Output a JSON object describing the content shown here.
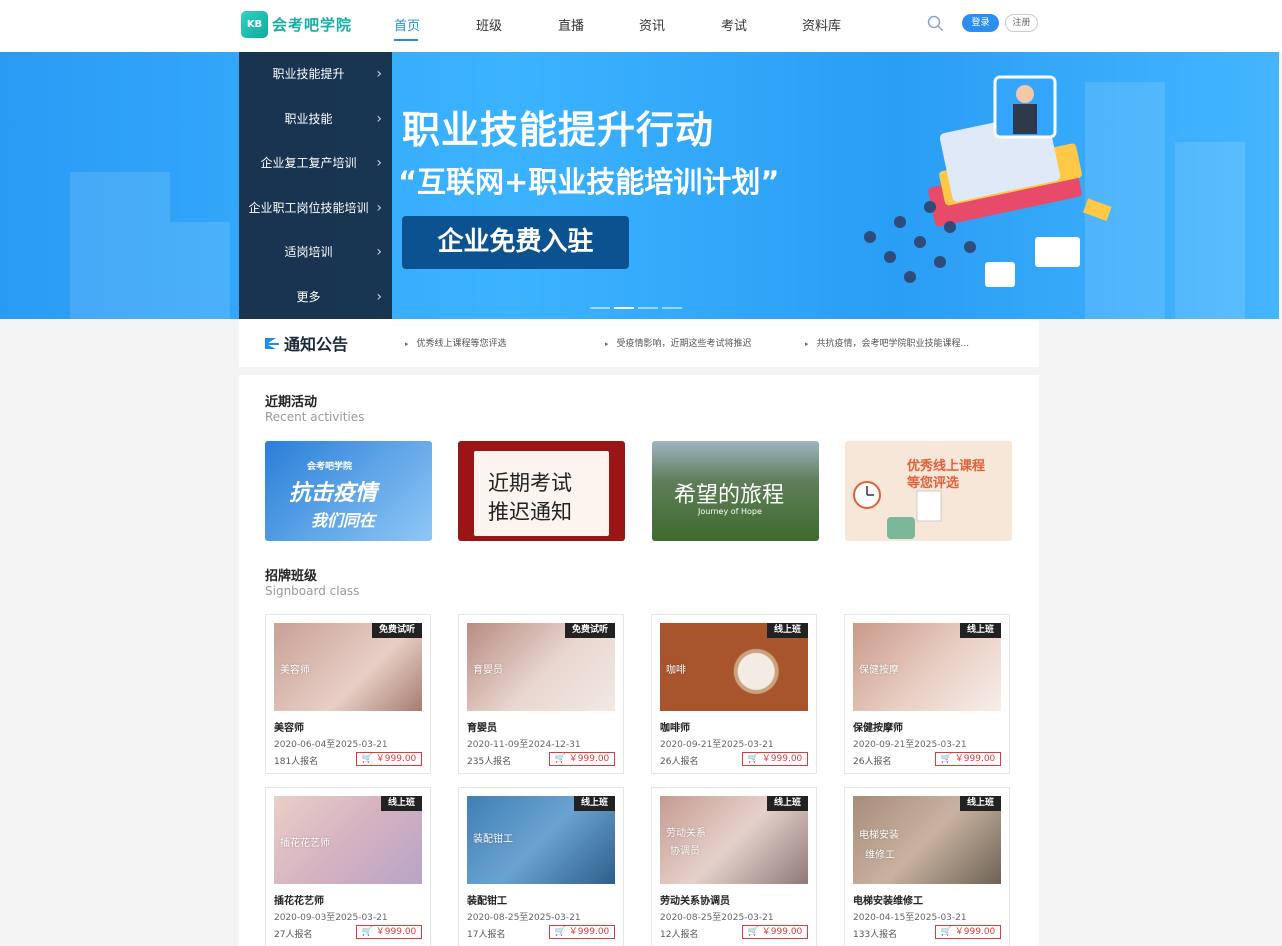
{
  "header": {
    "logo_text": "会考吧学院",
    "logo_mark": "KB",
    "nav": [
      "首页",
      "班级",
      "直播",
      "资讯",
      "考试",
      "资料库"
    ],
    "active_nav": "首页",
    "login_label": "登录",
    "register_label": "注册"
  },
  "banner": {
    "categories": [
      "职业技能提升",
      "职业技能",
      "企业复工复产培训",
      "企业职工岗位技能培训",
      "适岗培训",
      "更多"
    ],
    "title": "职业技能提升行动",
    "subtitle": "“互联网+职业技能培训计划”",
    "cta_label": "企业免费入驻",
    "slides_active": 2
  },
  "notice": {
    "title": "通知公告",
    "items": [
      "优秀线上课程等您评选",
      "受疫情影响，近期这些考试将推迟",
      "共抗疫情，会考吧学院职业技能课程..."
    ]
  },
  "recent": {
    "title": "近期活动",
    "subtitle": "Recent activities",
    "cards": [
      {
        "line1": "会考吧学院",
        "line2": "抗击疫情",
        "line3": "我们同在"
      },
      {
        "line1": "近期考试",
        "line2": "推迟通知"
      },
      {
        "line1": "希望的旅程",
        "line2": "Journey of Hope"
      },
      {
        "line1": "优秀线上课程",
        "line2": "等您评选"
      }
    ]
  },
  "classes": {
    "title": "招牌班级",
    "subtitle": "Signboard class",
    "items": [
      {
        "img_label": "美容师",
        "badge": "免费试听",
        "name": "美容师",
        "date": "2020-06-04至2025-03-21",
        "count": "181人报名",
        "price": "￥999.00"
      },
      {
        "img_label": "育婴员",
        "badge": "免费试听",
        "name": "育婴员",
        "date": "2020-11-09至2024-12-31",
        "count": "235人报名",
        "price": "￥999.00"
      },
      {
        "img_label": "咖啡",
        "badge": "线上班",
        "name": "咖啡师",
        "date": "2020-09-21至2025-03-21",
        "count": "26人报名",
        "price": "￥999.00"
      },
      {
        "img_label": "保健按摩",
        "badge": "线上班",
        "name": "保健按摩师",
        "date": "2020-09-21至2025-03-21",
        "count": "26人报名",
        "price": "￥999.00"
      },
      {
        "img_label": "插花花艺师",
        "badge": "线上班",
        "name": "插花花艺师",
        "date": "2020-09-03至2025-03-21",
        "count": "27人报名",
        "price": "￥999.00"
      },
      {
        "img_label": "装配钳工",
        "badge": "线上班",
        "name": "装配钳工",
        "date": "2020-08-25至2025-03-21",
        "count": "17人报名",
        "price": "￥999.00"
      },
      {
        "img_label": "劳动关系",
        "img_label2": "协调员",
        "badge": "线上班",
        "name": "劳动关系协调员",
        "date": "2020-08-25至2025-03-21",
        "count": "12人报名",
        "price": "￥999.00"
      },
      {
        "img_label": "电梯安装",
        "img_label2": "维修工",
        "badge": "线上班",
        "name": "电梯安装维修工",
        "date": "2020-04-15至2025-03-21",
        "count": "133人报名",
        "price": "￥999.00"
      }
    ]
  },
  "colors": {
    "accent": "#1f8fe6",
    "price": "#e03a3a",
    "logo": "#13b0a2"
  }
}
